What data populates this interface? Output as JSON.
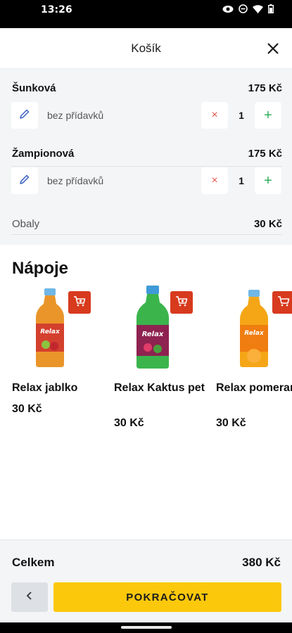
{
  "status_bar": {
    "time": "13:26"
  },
  "header": {
    "title": "Košík"
  },
  "cart_items": [
    {
      "name": "Šunková",
      "price": "175 Kč",
      "addons": "bez přídavků",
      "quantity": "1",
      "remove_symbol": "×",
      "add_symbol": "+"
    },
    {
      "name": "Žampionová",
      "price": "175 Kč",
      "addons": "bez přídavků",
      "quantity": "1",
      "remove_symbol": "×",
      "add_symbol": "+"
    }
  ],
  "packaging": {
    "label": "Obaly",
    "price": "30 Kč"
  },
  "drinks": {
    "title": "Nápoje",
    "items": [
      {
        "name": "Relax jablko",
        "price": "30 Kč",
        "bottle_color": "#e9952a",
        "cap_color": "#6fb7e6"
      },
      {
        "name": "Relax Kaktus pet",
        "price": "30 Kč",
        "bottle_color": "#3cb44c",
        "cap_color": "#3f9ad8"
      },
      {
        "name": "Relax pomeranč",
        "price": "30 Kč",
        "bottle_color": "#f4a617",
        "cap_color": "#6fb7e6"
      }
    ]
  },
  "footer": {
    "total_label": "Celkem",
    "total_value": "380 Kč",
    "continue_label": "POKRAČOVAT"
  },
  "colors": {
    "accent": "#fcc80c",
    "cart_button": "#d83a1e",
    "remove": "#e35a52",
    "add": "#2eae5b"
  }
}
